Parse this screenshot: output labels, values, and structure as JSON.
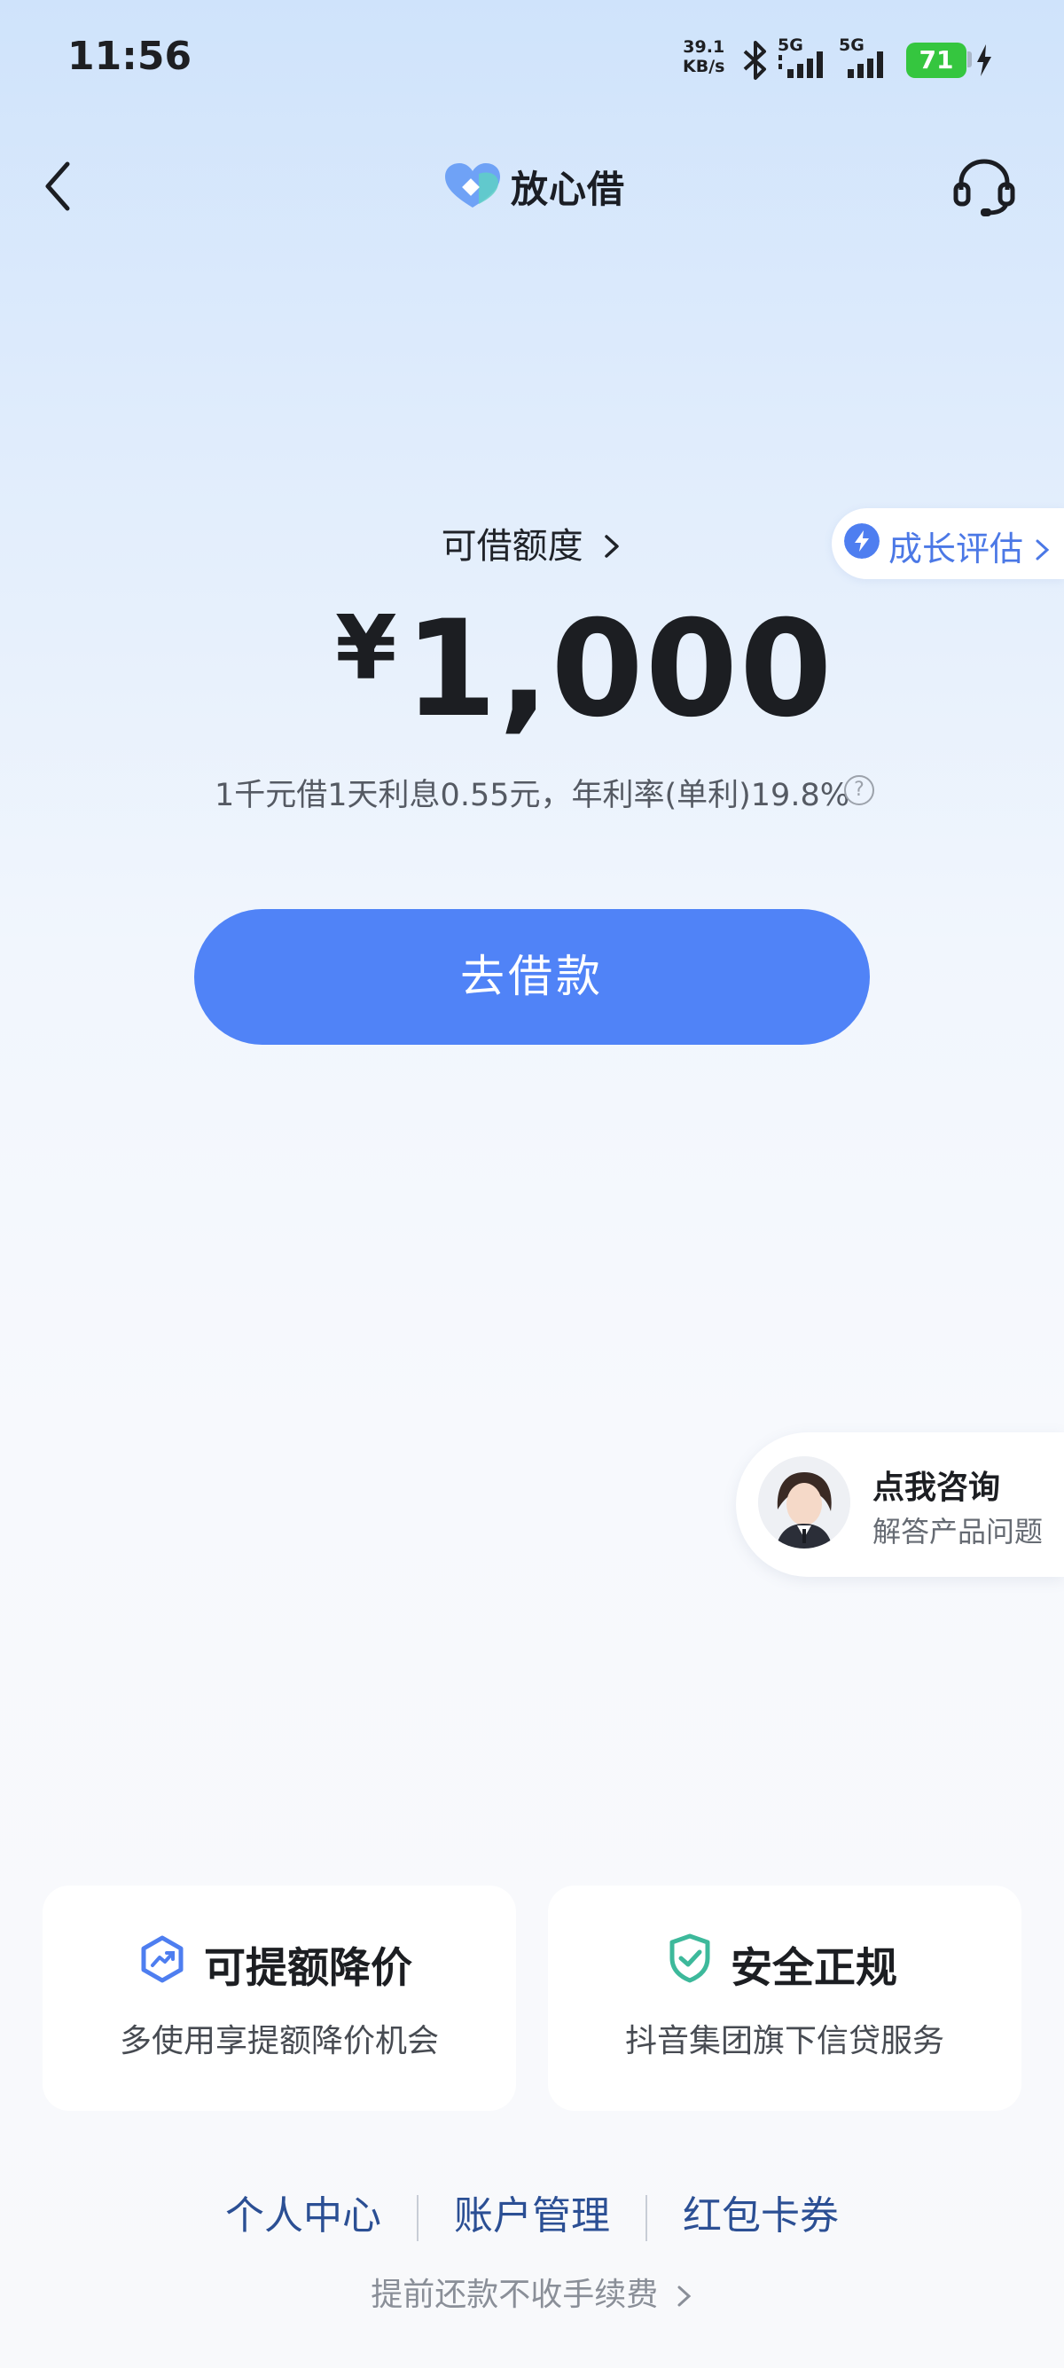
{
  "status_bar": {
    "time": "11:56",
    "net_speed_value": "39.1",
    "net_speed_unit": "KB/s",
    "network_1": "5G",
    "network_2": "5G",
    "battery": "71"
  },
  "header": {
    "title": "放心借",
    "back_icon": "chevron-left-icon",
    "support_icon": "headset-icon"
  },
  "credit": {
    "label": "可借额度",
    "currency": "¥",
    "amount": "1,000",
    "rate_text": "1千元借1天利息0.55元，年利率(单利)19.8%"
  },
  "growth": {
    "label": "成长评估"
  },
  "borrow_button": "去借款",
  "consult": {
    "title": "点我咨询",
    "subtitle": "解答产品问题"
  },
  "features": [
    {
      "title": "可提额降价",
      "subtitle": "多使用享提额降价机会",
      "icon": "growth-badge-icon"
    },
    {
      "title": "安全正规",
      "subtitle": "抖音集团旗下信贷服务",
      "icon": "shield-check-icon"
    }
  ],
  "bottom_links": [
    "个人中心",
    "账户管理",
    "红包卡券"
  ],
  "prepay_text": "提前还款不收手续费",
  "colors": {
    "primary": "#5083f7",
    "link": "#2b4f94",
    "battery": "#35c63f"
  }
}
